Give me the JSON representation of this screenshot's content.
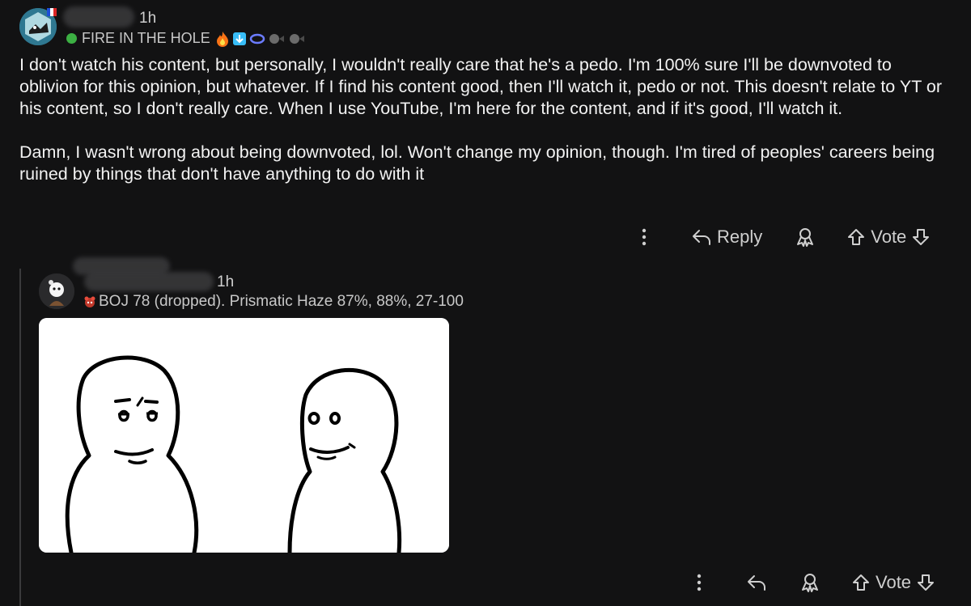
{
  "comment1": {
    "time": "1h",
    "flair": "FIRE IN THE HOLE",
    "paragraphs": [
      "I don't watch his content, but personally, I wouldn't really care that he's a pedo. I'm 100% sure I'll be downvoted to oblivion for this opinion, but whatever. If I find his content good, then I'll watch it, pedo or not. This doesn't relate to YT or his content, so I don't really care. When I use YouTube, I'm here for the content, and if it's good, I'll watch it.",
      "Damn, I wasn't wrong about being downvoted, lol. Won't change my opinion, though. I'm tired of peoples' careers being ruined by things that don't have anything to do with it"
    ],
    "actions": {
      "reply": "Reply",
      "vote": "Vote"
    }
  },
  "comment2": {
    "time": "1h",
    "flair": "BOJ 78 (dropped). Prismatic Haze 87%, 88%, 27-100",
    "actions": {
      "vote": "Vote"
    }
  },
  "icons": [
    "more-vertical-icon",
    "reply-arrow-icon",
    "award-icon",
    "upvote-arrow-icon",
    "downvote-arrow-icon"
  ],
  "colors": {
    "background": "#121213",
    "text": "#f2f2f2",
    "muted": "#cfcfcf",
    "flair_dot": "#3cb043"
  }
}
